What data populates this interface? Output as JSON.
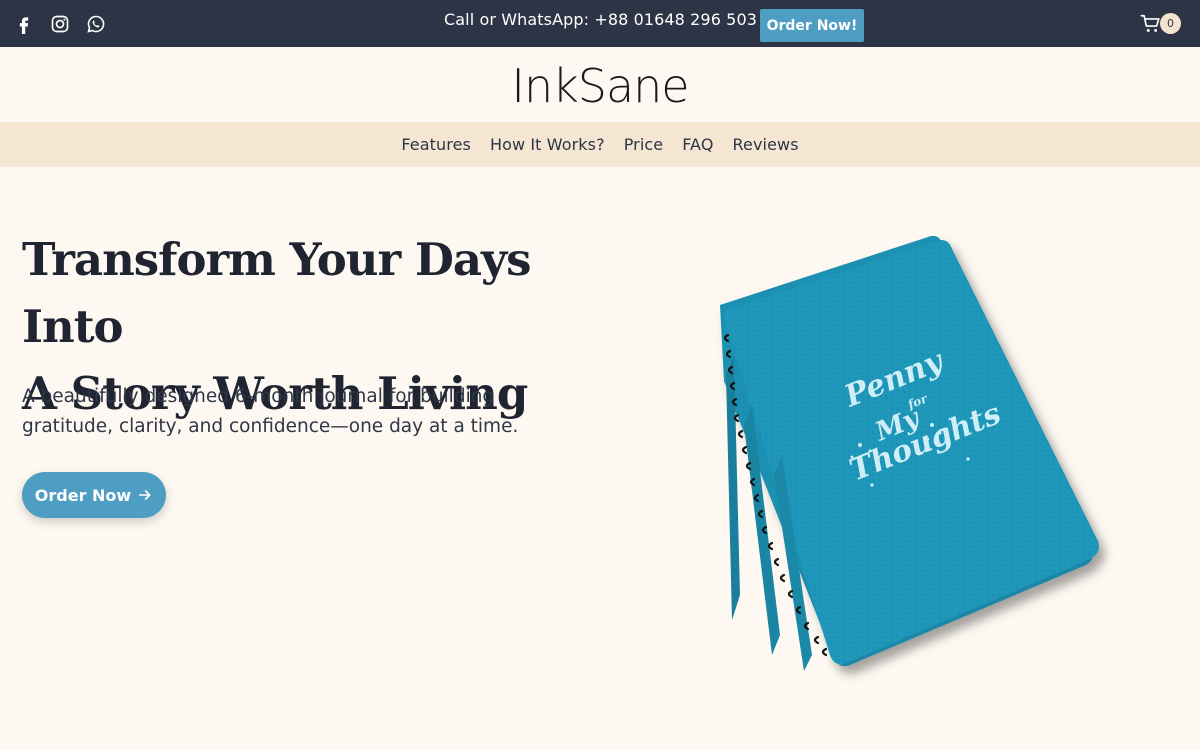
{
  "topbar": {
    "social": [
      {
        "name": "facebook-icon"
      },
      {
        "name": "instagram-icon"
      },
      {
        "name": "whatsapp-icon"
      }
    ],
    "contact": "Call or WhatsApp: +88 01648 296 503",
    "order_label": "Order Now!",
    "cart_count": "0"
  },
  "brand": {
    "logo": "InkSane"
  },
  "nav": {
    "items": [
      {
        "label": "Features"
      },
      {
        "label": "How It Works?"
      },
      {
        "label": "Price"
      },
      {
        "label": "FAQ"
      },
      {
        "label": "Reviews"
      }
    ]
  },
  "hero": {
    "title_line1": "Transform Your Days Into",
    "title_line2": "A Story Worth Living",
    "subtitle_line1": "A beautifully designed 6-month journal for building",
    "subtitle_line2": "gratitude, clarity, and confidence—one day at a time.",
    "cta_label": "Order Now",
    "cta_icon": "arrow-right-icon"
  },
  "product_image": {
    "cover_text": [
      "Penny",
      "for",
      "My",
      "Thoughts"
    ]
  },
  "colors": {
    "topbar_bg": "#2d3445",
    "accent": "#4e9ec4",
    "page_bg": "#fdf8f1",
    "nav_bg": "#f5e6d3",
    "journal_blue": "#1f95b8"
  }
}
